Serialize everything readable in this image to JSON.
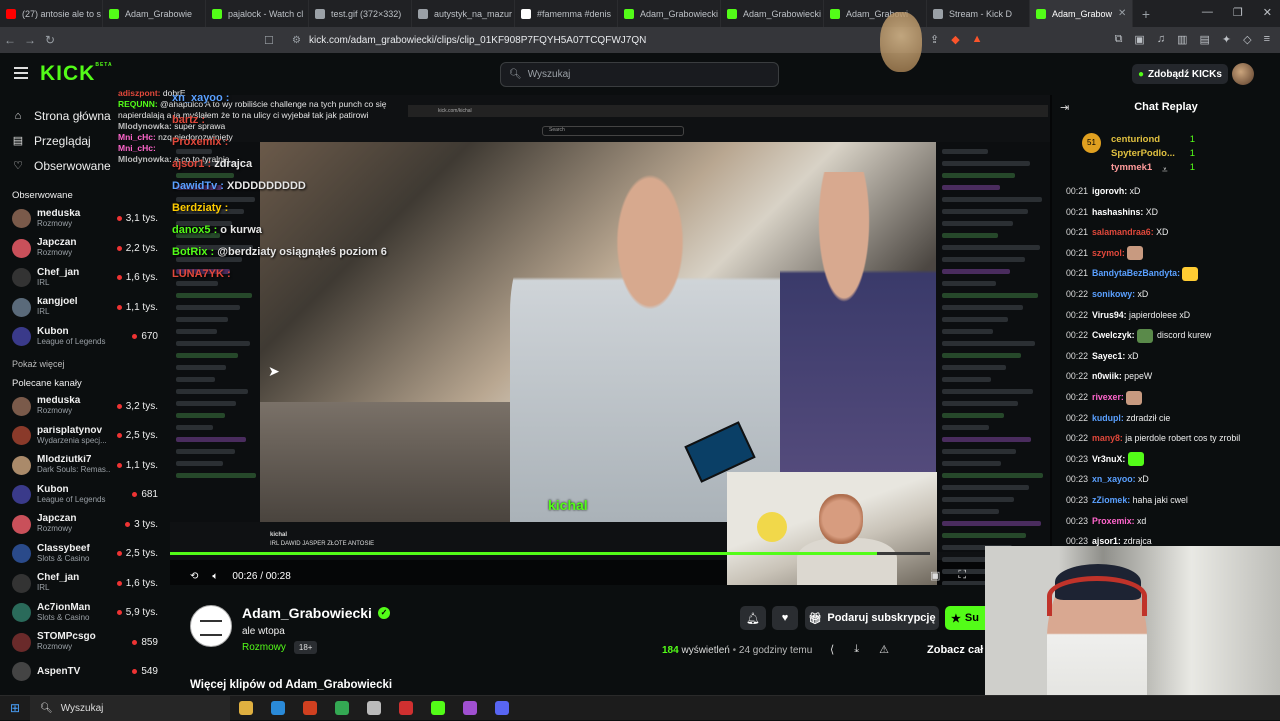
{
  "browser": {
    "tabs": [
      {
        "label": "(27) antosie ale to s",
        "color": "#ff0000"
      },
      {
        "label": "Adam_Grabowie",
        "color": "#53fc18"
      },
      {
        "label": "pajalock - Watch cl",
        "color": "#53fc18"
      },
      {
        "label": "test.gif (372×332)",
        "color": "#9aa0a6"
      },
      {
        "label": "autystyk_na_mazur",
        "color": "#9aa0a6"
      },
      {
        "label": "#famemma #denis",
        "color": "#ffffff"
      },
      {
        "label": "Adam_Grabowiecki",
        "color": "#53fc18"
      },
      {
        "label": "Adam_Grabowiecki",
        "color": "#53fc18"
      },
      {
        "label": "Adam_Grabowi",
        "color": "#53fc18"
      },
      {
        "label": "Stream - Kick D",
        "color": "#9aa0a6"
      },
      {
        "label": "Adam_Grabow",
        "color": "#53fc18",
        "active": true
      }
    ],
    "url": "kick.com/adam_grabowiecki/clips/clip_01KF908P7FQYH5A07TCQFWJ7QN"
  },
  "kick": {
    "logo": "KICK",
    "logo_beta": "BETA",
    "search_placeholder": "Wyszukaj",
    "get_kicks": "Zdobądź KICKs"
  },
  "sidebar": {
    "nav": [
      {
        "label": "Strona główna",
        "icon": "home-icon"
      },
      {
        "label": "Przeglądaj",
        "icon": "browse-icon"
      },
      {
        "label": "Obserwowane",
        "icon": "heart-icon"
      }
    ],
    "followed_title": "Obserwowane",
    "followed": [
      {
        "name": "meduska",
        "cat": "Rozmowy",
        "count": "3,1 tys.",
        "color": "#7a5a4a"
      },
      {
        "name": "Japczan",
        "cat": "Rozmowy",
        "count": "2,2 tys.",
        "color": "#c9505a"
      },
      {
        "name": "Chef_jan",
        "cat": "IRL",
        "count": "1,6 tys.",
        "color": "#333"
      },
      {
        "name": "kangjoel",
        "cat": "IRL",
        "count": "1,1 tys.",
        "color": "#5a6a7a"
      },
      {
        "name": "Kubon",
        "cat": "League of Legends",
        "count": "670",
        "color": "#3a3a8a"
      }
    ],
    "show_more": "Pokaż więcej",
    "recommended_title": "Polecane kanały",
    "recommended": [
      {
        "name": "meduska",
        "cat": "Rozmowy",
        "count": "3,2 tys.",
        "color": "#7a5a4a"
      },
      {
        "name": "parisplatynov",
        "cat": "Wydarzenia specj...",
        "count": "2,5 tys.",
        "color": "#8a3a2a"
      },
      {
        "name": "Mlodziutki7",
        "cat": "Dark Souls: Remas...",
        "count": "1,1 tys.",
        "color": "#aa8a6a"
      },
      {
        "name": "Kubon",
        "cat": "League of Legends",
        "count": "681",
        "color": "#3a3a8a"
      },
      {
        "name": "Japczan",
        "cat": "Rozmowy",
        "count": "3 tys.",
        "color": "#c9505a"
      },
      {
        "name": "Classybeef",
        "cat": "Slots & Casino",
        "count": "2,5 tys.",
        "color": "#2a4a8a"
      },
      {
        "name": "Chef_jan",
        "cat": "IRL",
        "count": "1,6 tys.",
        "color": "#333"
      },
      {
        "name": "Ac7ionMan",
        "cat": "Slots & Casino",
        "count": "5,9 tys.",
        "color": "#2a6a5a"
      },
      {
        "name": "STOMPcsgo",
        "cat": "Rozmowy",
        "count": "859",
        "color": "#6a2a2a"
      },
      {
        "name": "AspenTV",
        "cat": "",
        "count": "549",
        "color": "#444"
      }
    ]
  },
  "player": {
    "inner_url": "kick.com/kichal",
    "inner_search": "Search",
    "watermark": "kichal",
    "inner_channel": "kichal",
    "inner_title": "IRL DAWID JASPER ZŁOTE ANTOSIE",
    "time": "00:26 / 00:28",
    "progress": 0.93
  },
  "overlay_chat": [
    {
      "user": "adiszpont:",
      "msg": "dobrE",
      "color": "#e0483b"
    },
    {
      "user": "REQUNN:",
      "msg": "@ahapulco A to wy robiliście challenge na tych punch co się napierdalają a ja myślałem że to na ulicy ci wyjebał tak jak patirowi",
      "color": "#53fc18"
    },
    {
      "user": "Mlodynowka:",
      "msg": "super sprawa",
      "color": "#bbbbbb"
    },
    {
      "user": "Mni_cHc:",
      "msg": "nzq niedorozwinięty",
      "color": "#ff66cc"
    },
    {
      "user": "Mni_cHc:",
      "msg": "",
      "color": "#ff66cc"
    },
    {
      "user": "Mlodynowka:",
      "msg": "a co to tyralnia",
      "color": "#bbbbbb"
    }
  ],
  "big_chat": [
    {
      "user": "xn_xayoo :",
      "msg": "",
      "color": "#5aa0ff"
    },
    {
      "user": "bartz :",
      "msg": "",
      "color": "#e0483b"
    },
    {
      "user": "Proxemix :",
      "msg": "",
      "color": "#e0483b"
    },
    {
      "user": "ajsor1 :",
      "msg": "zdrajca",
      "color": "#e0483b"
    },
    {
      "user": "DawidTv :",
      "msg": "XDDDDDDDDD",
      "color": "#5aa0ff"
    },
    {
      "user": "Berdziaty :",
      "msg": "",
      "color": "#ffcc00"
    },
    {
      "user": "danox5 :",
      "msg": "o kurwa",
      "color": "#53fc18"
    },
    {
      "user": "BotRix :",
      "msg": "@berdziaty osiągnąłeś poziom 6",
      "color": "#53fc18"
    },
    {
      "user": "LUNA7YK :",
      "msg": "",
      "color": "#e0483b"
    }
  ],
  "channel": {
    "name": "Adam_Grabowiecki",
    "clip_title": "ale wtopa",
    "category": "Rozmowy",
    "age": "18+",
    "subscribe": "Podaruj subskrypcję",
    "follow": "Su",
    "views_count": "184",
    "views_label": "wyświetleń",
    "time_ago": "24 godziny temu",
    "see_all": "Zobacz cał",
    "more_clips": "Więcej klipów od Adam_Grabowiecki"
  },
  "chat_replay": {
    "title": "Chat Replay",
    "gifters": [
      {
        "name": "centuriond",
        "count": "1",
        "color": "#e0c040"
      },
      {
        "name": "SpyterPodlo...",
        "count": "1",
        "color": "#e0c040"
      },
      {
        "name": "tymmek1",
        "count": "1",
        "color": "#ff9b9b"
      }
    ],
    "gifter_level": "51",
    "messages": [
      {
        "time": "00:21",
        "user": "igorovh:",
        "msg": "xD",
        "color": "#ffffff"
      },
      {
        "time": "00:21",
        "user": "hashashins:",
        "msg": "XD",
        "color": "#ffffff"
      },
      {
        "time": "00:21",
        "user": "salamandraa6:",
        "msg": "XD",
        "color": "#e0483b"
      },
      {
        "time": "00:21",
        "user": "szymol:",
        "msg": "",
        "color": "#e0483b",
        "emote": "#c89a80"
      },
      {
        "time": "00:21",
        "user": "BandytaBezBandyta:",
        "msg": "",
        "color": "#5aa0ff",
        "emote": "#ffcc33"
      },
      {
        "time": "00:22",
        "user": "sonikowy:",
        "msg": "xD",
        "color": "#5aa0ff"
      },
      {
        "time": "00:22",
        "user": "Virus94:",
        "msg": "japierdoleee xD",
        "color": "#ffffff"
      },
      {
        "time": "00:22",
        "user": "Cwelczyk:",
        "msg": "discord kurew",
        "color": "#ffffff",
        "emote": "#5a8a4a"
      },
      {
        "time": "00:22",
        "user": "Sayec1:",
        "msg": "xD",
        "color": "#ffffff"
      },
      {
        "time": "00:22",
        "user": "n0wiik:",
        "msg": "pepeW",
        "color": "#ffffff"
      },
      {
        "time": "00:22",
        "user": "rivexer:",
        "msg": "",
        "color": "#ff66cc",
        "emote": "#c89a80"
      },
      {
        "time": "00:22",
        "user": "kudupl:",
        "msg": "zdradził cie",
        "color": "#5aa0ff"
      },
      {
        "time": "00:22",
        "user": "many8:",
        "msg": "ja pierdole robert cos ty zrobil",
        "color": "#e0483b"
      },
      {
        "time": "00:23",
        "user": "Vr3nuX:",
        "msg": "",
        "color": "#ffffff",
        "emote": "#53fc18"
      },
      {
        "time": "00:23",
        "user": "xn_xayoo:",
        "msg": "xD",
        "color": "#5aa0ff"
      },
      {
        "time": "00:23",
        "user": "zZiomek:",
        "msg": "haha jaki cwel",
        "color": "#5aa0ff"
      },
      {
        "time": "00:23",
        "user": "Proxemix:",
        "msg": "xd",
        "color": "#ff66cc"
      },
      {
        "time": "00:23",
        "user": "ajsor1:",
        "msg": "zdrajca",
        "color": "#ffffff"
      }
    ]
  },
  "taskbar": {
    "search": "Wyszukaj",
    "apps": [
      "#e0b040",
      "#2a8ad8",
      "#d04020",
      "#34a853",
      "#bbbbbb",
      "#d03030",
      "#53fc18",
      "#a050d0",
      "#5865f2"
    ]
  }
}
